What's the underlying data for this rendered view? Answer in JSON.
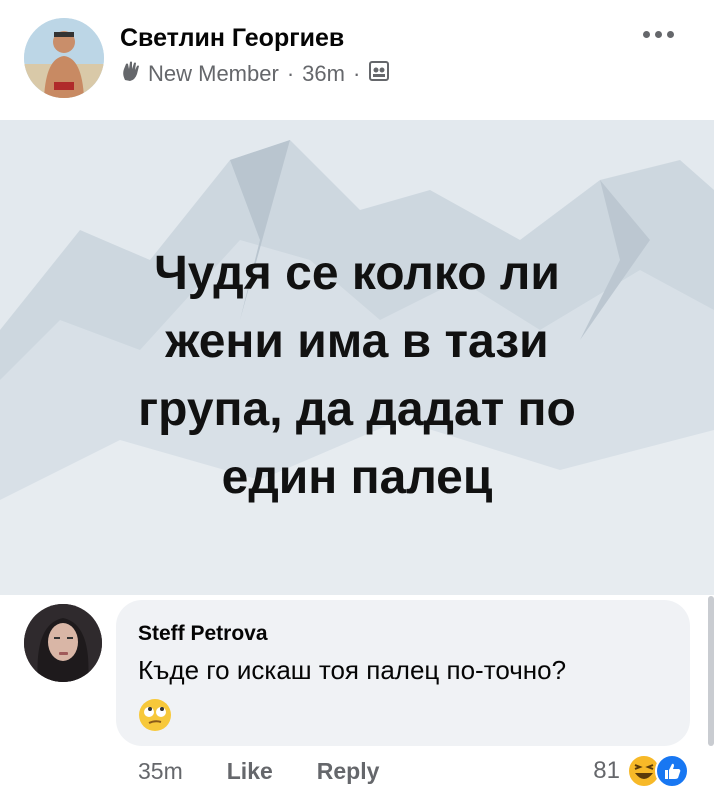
{
  "post": {
    "author": "Светлин Георгиев",
    "badge": "New Member",
    "time": "36m",
    "separator": "·",
    "image_text_lines": [
      "Чудя се колко ли",
      "жени има в тази",
      "група, да дадат по",
      "един палец"
    ]
  },
  "comment": {
    "author": "Steff Petrova",
    "text": "Къде го искаш тоя палец по-точно?",
    "time": "35m",
    "like_label": "Like",
    "reply_label": "Reply",
    "reaction_count": "81"
  },
  "colors": {
    "secondary_text": "#65676b",
    "bubble": "#f0f2f5",
    "like_blue": "#1877f2",
    "haha_yellow": "#f7b928"
  }
}
